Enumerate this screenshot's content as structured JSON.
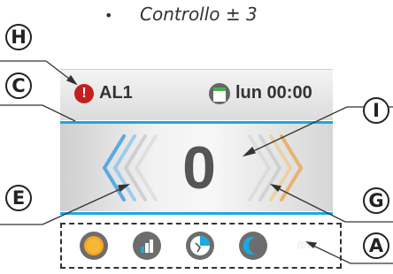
{
  "title": {
    "bullet": "•",
    "text": "Controllo ± 3"
  },
  "status_bar": {
    "alarm_label": "AL1",
    "alarm_symbol": "!",
    "time_label": "lun 00:00"
  },
  "setpoint": {
    "value": "0"
  },
  "callouts": {
    "h": "H",
    "c": "C",
    "i": "I",
    "e": "E",
    "g": "G",
    "a": "A"
  },
  "mode_bar": {
    "icons": [
      "sun-icon",
      "bar-chart-icon",
      "clock-program-icon",
      "moon-icon"
    ],
    "faded_text": "ℓℓ/0"
  },
  "colors": {
    "accent_blue": "#1aa9e1",
    "alarm_red": "#c41f1f",
    "sun_orange": "#f5a623",
    "chevron_left": "#4fa8e0",
    "chevron_right": "#e8b064"
  }
}
